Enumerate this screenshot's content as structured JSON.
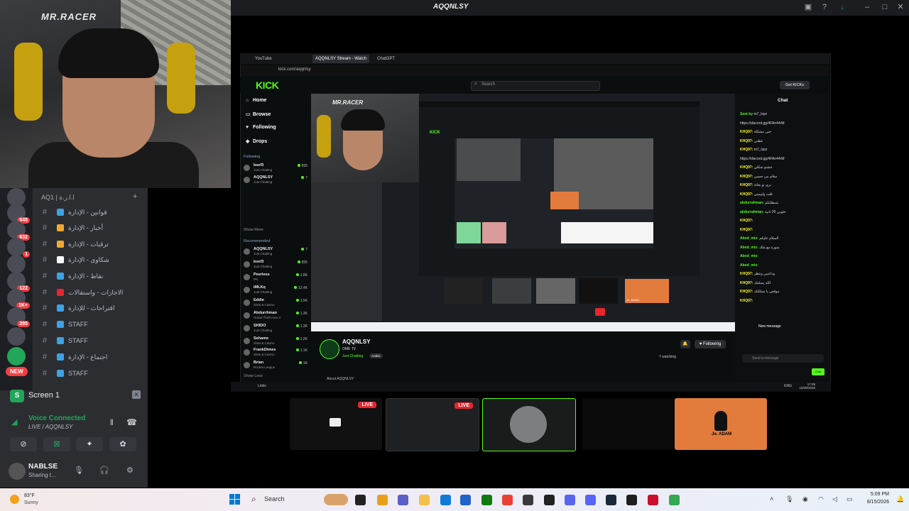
{
  "window": {
    "title": "AQQNLSY"
  },
  "webcam": {
    "brand": "MR.RACER"
  },
  "discord": {
    "server_name": "AQ1 | ا.ا.ر.ة",
    "server_badges": [
      "945",
      "632",
      "1",
      "122",
      "1K+",
      "295"
    ],
    "new_label": "NEW",
    "channels": [
      {
        "label": "قوانين - الإدارة",
        "color": "#3ba3e6"
      },
      {
        "label": "أخبار - الإدارة",
        "color": "#f0a830"
      },
      {
        "label": "ترقيات - الإدارة",
        "color": "#f0a830"
      },
      {
        "label": "شكاوى - الإدارة",
        "color": "#ffffff"
      },
      {
        "label": "نقاط - الإدارة",
        "color": "#3ba3e6"
      },
      {
        "label": "الاجازات - واستقالات",
        "color": "#e6262e"
      },
      {
        "label": "اقتراحات - للإدارة",
        "color": "#3ba3e6"
      },
      {
        "label": "STAFF",
        "color": "#3ba3e6"
      },
      {
        "label": "STAFF",
        "color": "#3ba3e6"
      },
      {
        "label": "اجتماع - الإدارة",
        "color": "#3ba3e6"
      },
      {
        "label": "STAFF",
        "color": "#3ba3e6"
      }
    ],
    "screen_label": "Screen 1",
    "voice_status": "Voice Connected",
    "voice_channel": "LIVE / AQQNLSY",
    "user_name": "NABLSE",
    "user_status": "Sharing t..."
  },
  "browser": {
    "tabs": [
      "YouTube",
      "AQQNLSY Stream - Watch",
      "ChatGPT"
    ],
    "url": "kick.com/aqqnlsy",
    "search_placeholder": "Search",
    "get_kicks": "Get KICKs"
  },
  "kick": {
    "logo": "KICK",
    "nav": [
      {
        "label": "Home",
        "icon": "⌂"
      },
      {
        "label": "Browse",
        "icon": "▭"
      },
      {
        "label": "Following",
        "icon": "♥"
      },
      {
        "label": "Drops",
        "icon": "◆"
      }
    ],
    "following_title": "Following",
    "following": [
      {
        "name": "bsef3",
        "cat": "Just Chatting",
        "viewers": "895"
      },
      {
        "name": "AQQNLSY",
        "cat": "Just Chatting",
        "viewers": "7"
      }
    ],
    "show_more": "Show More",
    "recommended_title": "Recommended",
    "recommended": [
      {
        "name": "AQQNLSY",
        "cat": "Just Chatting",
        "viewers": "7"
      },
      {
        "name": "bsef3",
        "cat": "Just Chatting",
        "viewers": "895"
      },
      {
        "name": "Peerless",
        "cat": "IRL",
        "viewers": "1.8K"
      },
      {
        "name": "iMLKq",
        "cat": "Just Chatting",
        "viewers": "12.4K"
      },
      {
        "name": "Eddie",
        "cat": "Slots & Casino",
        "viewers": "1.5K"
      },
      {
        "name": "Abdurrhman",
        "cat": "Grand Theft Auto V",
        "viewers": "1.3K"
      },
      {
        "name": "SHIDO",
        "cat": "Just Chatting",
        "viewers": "1.3K"
      },
      {
        "name": "Sehamx",
        "cat": "Slots & Casino",
        "viewers": "1.2K"
      },
      {
        "name": "FrankDimes",
        "cat": "Slots & Casino",
        "viewers": "1.1K"
      },
      {
        "name": "Brian",
        "cat": "Rocket League",
        "viewers": "1K"
      }
    ],
    "show_less": "Show Less",
    "channel_name": "AQQNLSY",
    "channel_sub": "OME TV",
    "channel_cat": "Just Chatting",
    "channel_tag": "Arabic",
    "following_btn": "Following",
    "watching": "7 watching",
    "about": "About AQQNLSY",
    "chat_title": "Chat",
    "chat_messages": [
      {
        "user": "Sent by",
        "text": "m7_lxpz",
        "yellow": false
      },
      {
        "user": "",
        "text": "https://discord.gg/4FAn44rM",
        "yellow": false
      },
      {
        "user": "KHQ97:",
        "text": "حتى مشكلة",
        "yellow": true
      },
      {
        "user": "KHQ97:",
        "text": "عطني",
        "yellow": true
      },
      {
        "user": "KHQ97:",
        "text": "m7_lxpz",
        "yellow": true
      },
      {
        "user": "",
        "text": "https://discord.gg/4FAn44rM",
        "yellow": false
      },
      {
        "user": "KHQ97:",
        "text": "خشتو شكلي",
        "yellow": true
      },
      {
        "user": "KHQ97:",
        "text": "سلام من حسين",
        "yellow": true
      },
      {
        "user": "KHQ97:",
        "text": "ترى تو بغاتة",
        "yellow": true
      },
      {
        "user": "KHQ97:",
        "text": "قلت ولبيسي",
        "yellow": true
      },
      {
        "user": "abdurrahman:",
        "text": "شيطلتكم",
        "yellow": false
      },
      {
        "user": "abdurrahman:",
        "text": "خلوني 20 ثانية",
        "yellow": false
      },
      {
        "user": "KHQ97:",
        "text": "",
        "yellow": true
      },
      {
        "user": "KHQ97:",
        "text": "",
        "yellow": true
      },
      {
        "user": "Abod_mix:",
        "text": "السلام عليكم",
        "yellow": false
      },
      {
        "user": "Abod_mix:",
        "text": "منورة مع ملك",
        "yellow": false
      },
      {
        "user": "Abod_mix:",
        "text": "",
        "yellow": false
      },
      {
        "user": "Abod_mix:",
        "text": "",
        "yellow": false
      },
      {
        "user": "KHQ97:",
        "text": "وداعبين ونتظر",
        "yellow": true
      },
      {
        "user": "KHQ97:",
        "text": "الله يسلمك",
        "yellow": true
      },
      {
        "user": "KHQ97:",
        "text": "موقعي يا مملكتك",
        "yellow": true
      },
      {
        "user": "KHQ97:",
        "text": "",
        "yellow": true
      }
    ],
    "new_message": "New message",
    "chat_input": "Send a message",
    "chat_send": "Chat"
  },
  "inner_taskbar": {
    "search_label": "Links",
    "lang": "ENG",
    "time": "17:09",
    "date": "15/08/2026"
  },
  "stream_tiles": [
    {
      "live": "LIVE"
    },
    {
      "live": "LIVE"
    },
    {
      "live": ""
    },
    {
      "live": ""
    },
    {
      "live": "",
      "label": "Jo. ADAM"
    }
  ],
  "taskbar": {
    "temp": "83°F",
    "weather": "Sunny",
    "search": "Search",
    "time": "5:09 PM",
    "date": "8/15/2026",
    "apps": [
      {
        "color": "#222222"
      },
      {
        "color": "#e8a019"
      },
      {
        "color": "#5b5fc7"
      },
      {
        "color": "#f2c14b"
      },
      {
        "color": "#0f7bd6"
      },
      {
        "color": "#2163c6"
      },
      {
        "color": "#107c10"
      },
      {
        "color": "#e94235"
      },
      {
        "color": "#3a3a3a"
      },
      {
        "color": "#222222"
      },
      {
        "color": "#5865f2"
      },
      {
        "color": "#5865f2"
      },
      {
        "color": "#1b2838"
      },
      {
        "color": "#1f1f1f"
      },
      {
        "color": "#c8102e"
      },
      {
        "color": "#34a853"
      }
    ]
  }
}
